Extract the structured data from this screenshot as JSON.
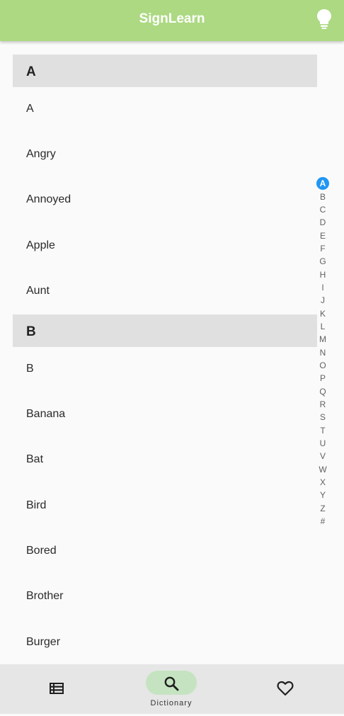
{
  "appbar": {
    "title": "SignLearn",
    "icon": "lightbulb-icon"
  },
  "sections": [
    {
      "letter": "A",
      "items": [
        "A",
        "Angry",
        "Annoyed",
        "Apple",
        "Aunt"
      ]
    },
    {
      "letter": "B",
      "items": [
        "B",
        "Banana",
        "Bat",
        "Bird",
        "Bored",
        "Brother",
        "Burger"
      ]
    }
  ],
  "index": {
    "letters": [
      "A",
      "B",
      "C",
      "D",
      "E",
      "F",
      "G",
      "H",
      "I",
      "J",
      "K",
      "L",
      "M",
      "N",
      "O",
      "P",
      "Q",
      "R",
      "S",
      "T",
      "U",
      "V",
      "W",
      "X",
      "Y",
      "Z",
      "#"
    ],
    "active": "A",
    "active_color": "#2196f3"
  },
  "bottom_nav": {
    "items": [
      {
        "icon": "list-icon",
        "label": ""
      },
      {
        "icon": "search-icon",
        "label": "Dictionary"
      },
      {
        "icon": "heart-icon",
        "label": ""
      }
    ],
    "selected": "Dictionary"
  },
  "colors": {
    "appbar": "#acd982",
    "section_header": "#e0e0e0",
    "nav_pill": "#c5e3c1",
    "bottom_nav": "#e6e6e6"
  }
}
